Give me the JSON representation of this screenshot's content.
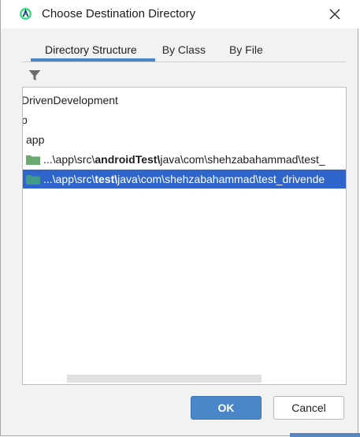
{
  "window": {
    "title": "Choose Destination Directory"
  },
  "tabs": [
    {
      "label": "Directory Structure",
      "active": true
    },
    {
      "label": "By Class",
      "active": false
    },
    {
      "label": "By File",
      "active": false
    }
  ],
  "tree": {
    "rows": [
      {
        "text": "DrivenDevelopment"
      },
      {
        "text": "p"
      },
      {
        "text": "app"
      },
      {
        "prefix": "...\\app\\src\\",
        "bold": "androidTest\\",
        "suffix": "java\\com\\shehzabahammad\\test_"
      },
      {
        "prefix": "...\\app\\src\\",
        "bold": "test\\",
        "suffix": "java\\com\\shehzabahammad\\test_drivende",
        "selected": true
      }
    ]
  },
  "buttons": {
    "ok_label": "OK",
    "cancel_label": "Cancel"
  },
  "colors": {
    "accent": "#4a86c7",
    "selection": "#2f65ca",
    "folder": "#6aa96f"
  },
  "icons": {
    "app": "android-studio-icon",
    "close": "close-icon",
    "filter": "filter-icon",
    "folder": "folder-icon"
  }
}
